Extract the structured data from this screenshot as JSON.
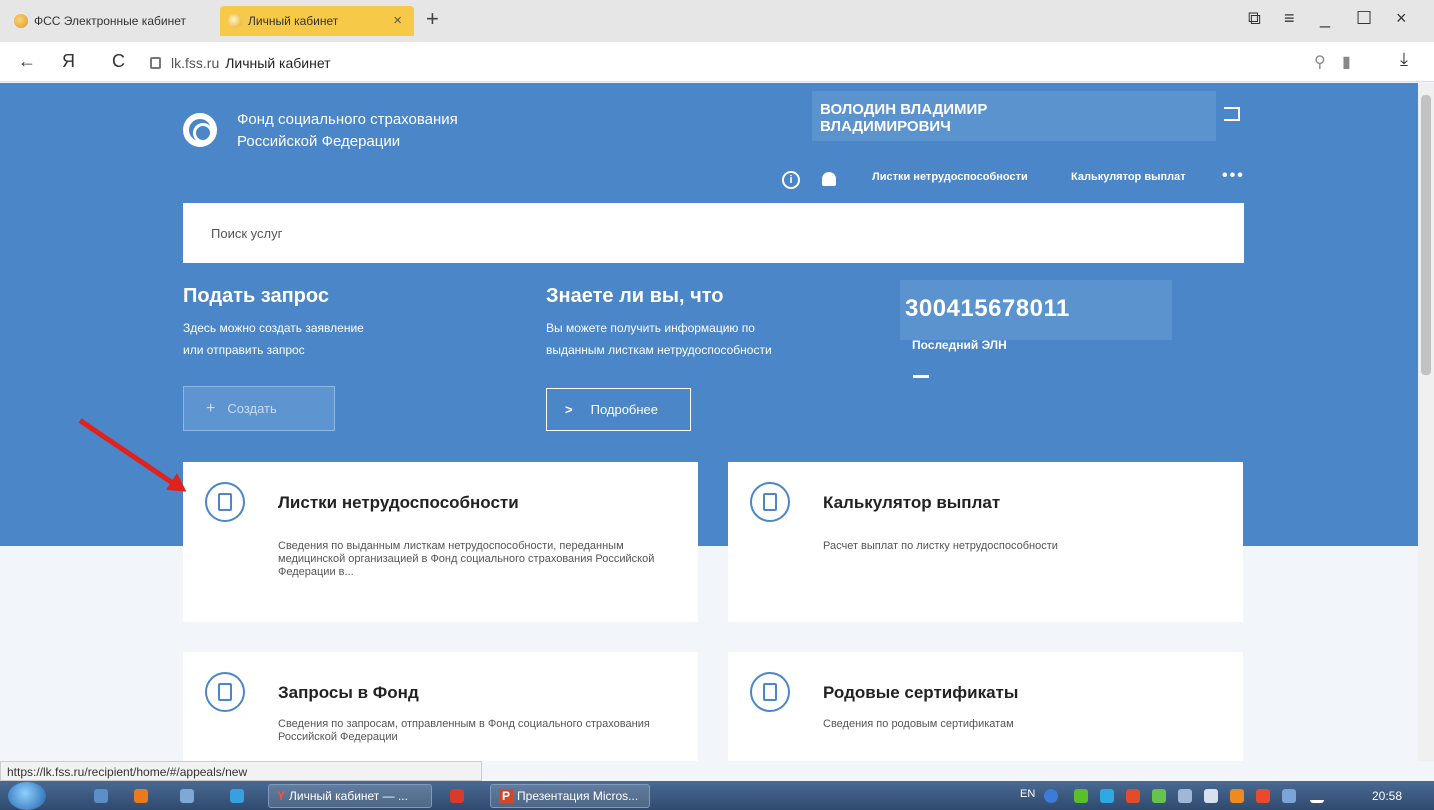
{
  "browser": {
    "tabs": [
      {
        "label": "ФСС Электронные кабинет"
      },
      {
        "label": "Личный кабинет"
      }
    ],
    "close_glyph": "×",
    "newtab_glyph": "+",
    "back_glyph": "←",
    "yandex_glyph": "Я",
    "reload_glyph": "C",
    "url_domain": "lk.fss.ru",
    "url_title": "Личный кабинет",
    "window_controls": [
      "⧉",
      "≡",
      "_",
      "☐",
      "×"
    ],
    "download_glyph": "⤓",
    "status_url": "https://lk.fss.ru/recipient/home/#/appeals/new"
  },
  "header": {
    "org_line1": "Фонд социального страхования",
    "org_line2": "Российской Федерации",
    "user_line1": "ВОЛОДИН ВЛАДИМИР",
    "user_line2": "ВЛАДИМИРОВИЧ",
    "info_glyph": "i",
    "nav": [
      "Листки нетрудоспособности",
      "Калькулятор выплат"
    ],
    "more_glyph": "•••"
  },
  "search": {
    "placeholder": "Поиск услуг"
  },
  "request": {
    "title": "Подать запрос",
    "text1": "Здесь можно создать заявление",
    "text2": "или отправить запрос",
    "button": "Создать",
    "button_glyph": "+"
  },
  "didyouknow": {
    "title": "Знаете ли вы, что",
    "text1": "Вы можете получить информацию по",
    "text2": "выданным листкам нетрудоспособности",
    "button": "Подробнее",
    "button_glyph": ">"
  },
  "eln": {
    "number": "300415678011",
    "label": "Последний ЭЛН"
  },
  "cards": [
    {
      "title": "Листки нетрудоспособности",
      "desc": "Сведения по выданным листкам нетрудоспособности, переданным медицинской организацией в Фонд социального страхования Российской Федерации в..."
    },
    {
      "title": "Калькулятор выплат",
      "desc": "Расчет выплат по листку нетрудоспособности"
    },
    {
      "title": "Запросы в Фонд",
      "desc": "Сведения по запросам, отправленным в Фонд социального страхования Российской Федерации"
    },
    {
      "title": "Родовые сертификаты",
      "desc": "Сведения по родовым сертификатам"
    }
  ],
  "taskbar": {
    "tasks": [
      "Личный кабинет — ...",
      "Презентация Micros..."
    ],
    "lang": "EN",
    "time": "20:58"
  },
  "colors": {
    "hero": "#4a86c8",
    "accent": "#f7c948",
    "arrow": "#e0211c"
  }
}
